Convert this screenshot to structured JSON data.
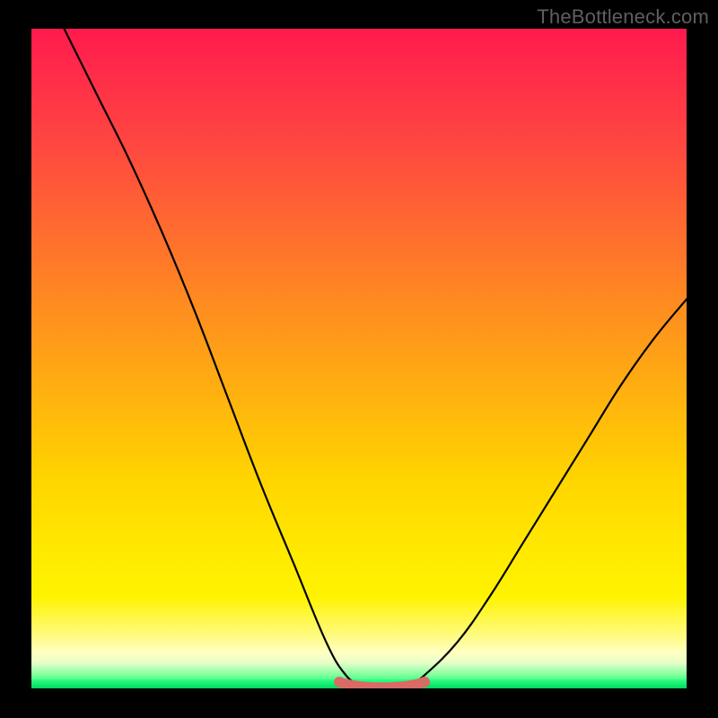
{
  "watermark": "TheBottleneck.com",
  "chart_data": {
    "type": "line",
    "title": "",
    "xlabel": "",
    "ylabel": "",
    "xlim": [
      0,
      100
    ],
    "ylim": [
      0,
      100
    ],
    "grid": false,
    "series": [
      {
        "name": "bottleneck-curve",
        "x": [
          5,
          10,
          15,
          20,
          25,
          30,
          35,
          40,
          45,
          48,
          50,
          52,
          55,
          58,
          60,
          65,
          70,
          75,
          80,
          85,
          90,
          95,
          100
        ],
        "y": [
          100,
          90,
          80,
          69,
          57,
          44,
          31,
          19,
          7,
          2,
          0.8,
          0.5,
          0.5,
          0.8,
          2,
          7,
          14,
          22,
          30,
          38,
          46,
          53,
          59
        ]
      }
    ],
    "highlight_range": {
      "name": "optimal-zone",
      "x_start": 47,
      "x_end": 60,
      "y_level": 0.7,
      "color": "#d96a66"
    },
    "background_gradient": {
      "stops": [
        {
          "pos": 0.0,
          "color": "#ff1a4d"
        },
        {
          "pos": 0.18,
          "color": "#ff4840"
        },
        {
          "pos": 0.42,
          "color": "#ff8c20"
        },
        {
          "pos": 0.68,
          "color": "#ffd400"
        },
        {
          "pos": 0.86,
          "color": "#fff300"
        },
        {
          "pos": 0.95,
          "color": "#ffffc0"
        },
        {
          "pos": 0.98,
          "color": "#7dff9a"
        },
        {
          "pos": 1.0,
          "color": "#00e86b"
        }
      ]
    }
  }
}
